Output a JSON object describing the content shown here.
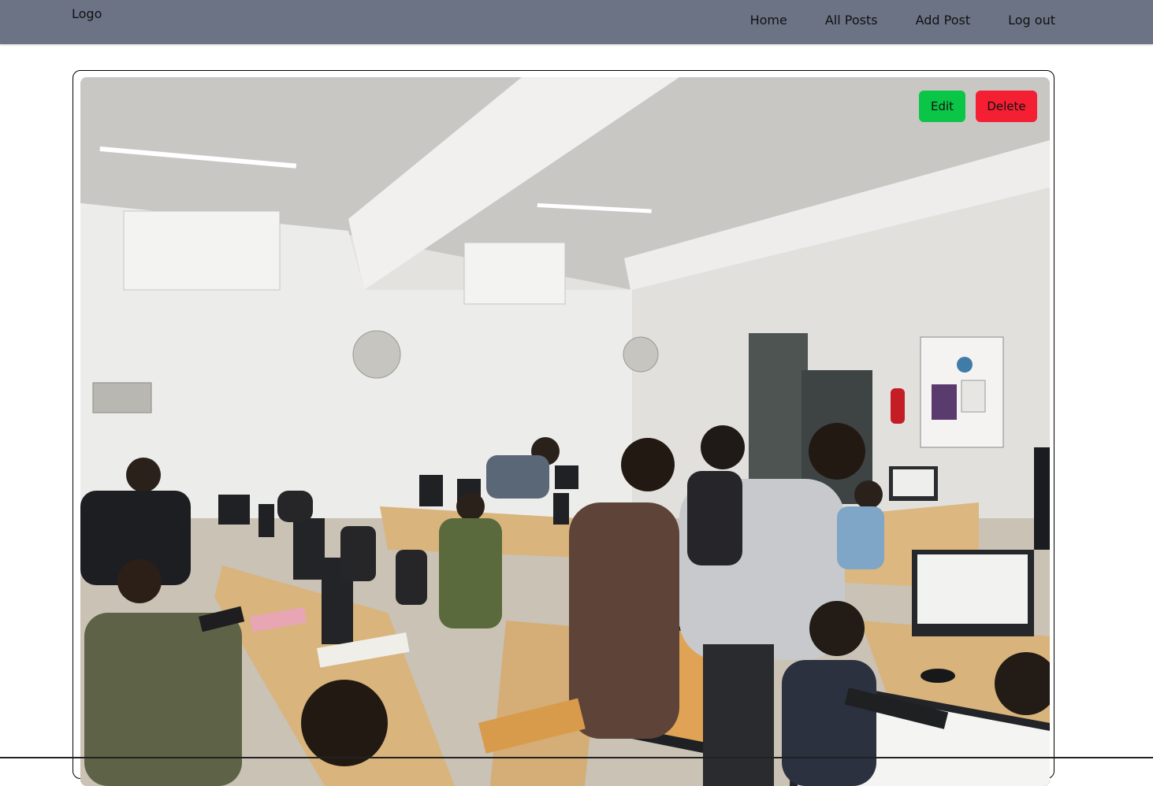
{
  "navbar": {
    "logo": "Logo",
    "links": [
      {
        "label": "Home"
      },
      {
        "label": "All Posts"
      },
      {
        "label": "Add Post"
      },
      {
        "label": "Log out"
      }
    ],
    "background_color": "#6b7385"
  },
  "post": {
    "image_alt": "Classroom computer lab photo",
    "actions": {
      "edit_label": "Edit",
      "delete_label": "Delete",
      "edit_color": "#0bc646",
      "delete_color": "#f41f33"
    }
  }
}
